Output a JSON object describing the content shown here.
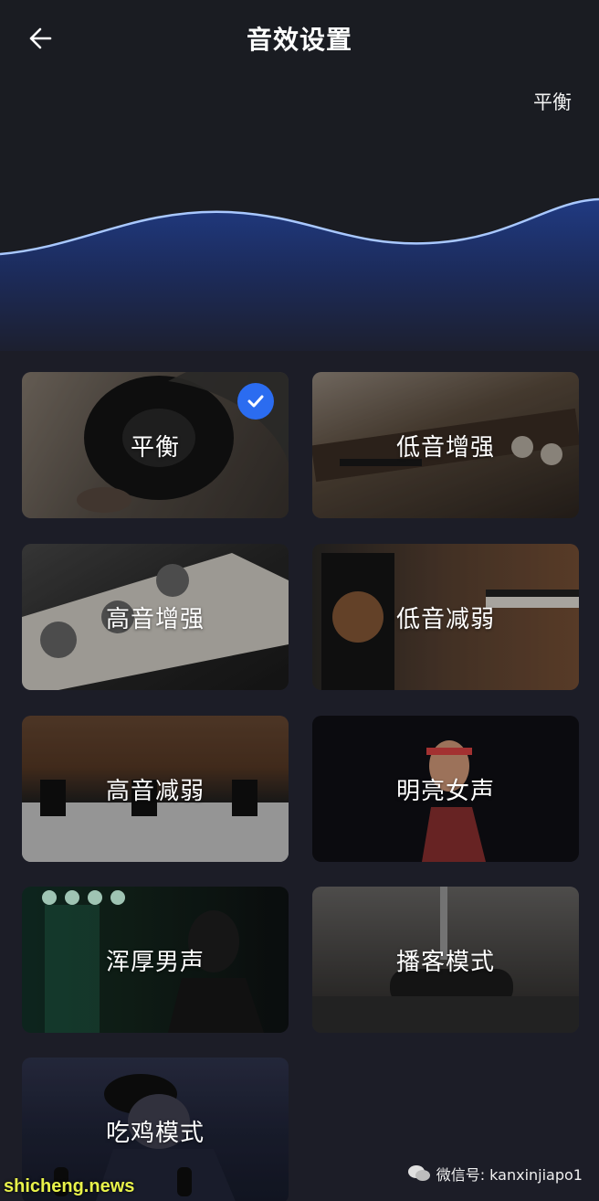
{
  "header": {
    "title": "音效设置",
    "current_preset": "平衡"
  },
  "presets": [
    {
      "label": "平衡",
      "selected": true
    },
    {
      "label": "低音增强",
      "selected": false
    },
    {
      "label": "高音增强",
      "selected": false
    },
    {
      "label": "低音减弱",
      "selected": false
    },
    {
      "label": "高音减弱",
      "selected": false
    },
    {
      "label": "明亮女声",
      "selected": false
    },
    {
      "label": "浑厚男声",
      "selected": false
    },
    {
      "label": "播客模式",
      "selected": false
    },
    {
      "label": "吃鸡模式",
      "selected": false
    }
  ],
  "watermark": {
    "site": "shicheng.news",
    "wechat": "微信号: kanxinjiapo1"
  },
  "colors": {
    "background": "#1c1d27",
    "accent": "#2b6cf0",
    "wave_line": "#a9c8ff"
  }
}
